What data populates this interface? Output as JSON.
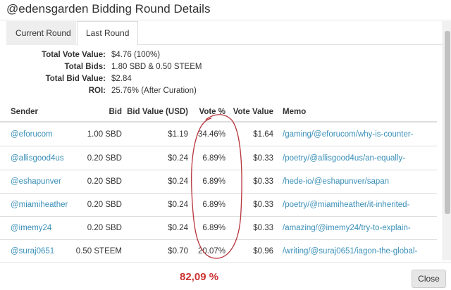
{
  "modal": {
    "title": "@edensgarden Bidding Round Details",
    "close_label": "Close"
  },
  "tabs": [
    {
      "label": "Current Round",
      "active": false
    },
    {
      "label": "Last Round",
      "active": true
    }
  ],
  "summary": [
    {
      "label": "Total Vote Value:",
      "value": "$4.76 (100%)"
    },
    {
      "label": "Total Bids:",
      "value": "1.80 SBD & 0.50 STEEM"
    },
    {
      "label": "Total Bid Value:",
      "value": "$2.84"
    },
    {
      "label": "ROI:",
      "value": "25.76% (After Curation)"
    }
  ],
  "table": {
    "headers": [
      "Sender",
      "Bid",
      "Bid Value (USD)",
      "Vote %",
      "Vote Value",
      "Memo"
    ],
    "rows": [
      {
        "sender": "@eforucom",
        "bid": "1.00 SBD",
        "bid_value": "$1.19",
        "vote_pct": "34.46%",
        "vote_value": "$1.64",
        "memo": "/gaming/@eforucom/why-is-counter-"
      },
      {
        "sender": "@allisgood4us",
        "bid": "0.20 SBD",
        "bid_value": "$0.24",
        "vote_pct": "6.89%",
        "vote_value": "$0.33",
        "memo": "/poetry/@allisgood4us/an-equally-"
      },
      {
        "sender": "@eshapunver",
        "bid": "0.20 SBD",
        "bid_value": "$0.24",
        "vote_pct": "6.89%",
        "vote_value": "$0.33",
        "memo": "/hede-io/@eshapunver/sapan"
      },
      {
        "sender": "@miamiheather",
        "bid": "0.20 SBD",
        "bid_value": "$0.24",
        "vote_pct": "6.89%",
        "vote_value": "$0.33",
        "memo": "/poetry/@miamiheather/it-inherited-"
      },
      {
        "sender": "@imemy24",
        "bid": "0.20 SBD",
        "bid_value": "$0.24",
        "vote_pct": "6.89%",
        "vote_value": "$0.33",
        "memo": "/amazing/@imemy24/try-to-explain-"
      },
      {
        "sender": "@suraj0651",
        "bid": "0.50 STEEM",
        "bid_value": "$0.70",
        "vote_pct": "20.07%",
        "vote_value": "$0.96",
        "memo": "/writing/@suraj0651/iagon-the-global-"
      }
    ]
  },
  "annotation": {
    "total_text": "82,09 %",
    "color": "#cc3333"
  },
  "colors": {
    "link": "#3a8fb7",
    "annotation": "#cc3333"
  }
}
